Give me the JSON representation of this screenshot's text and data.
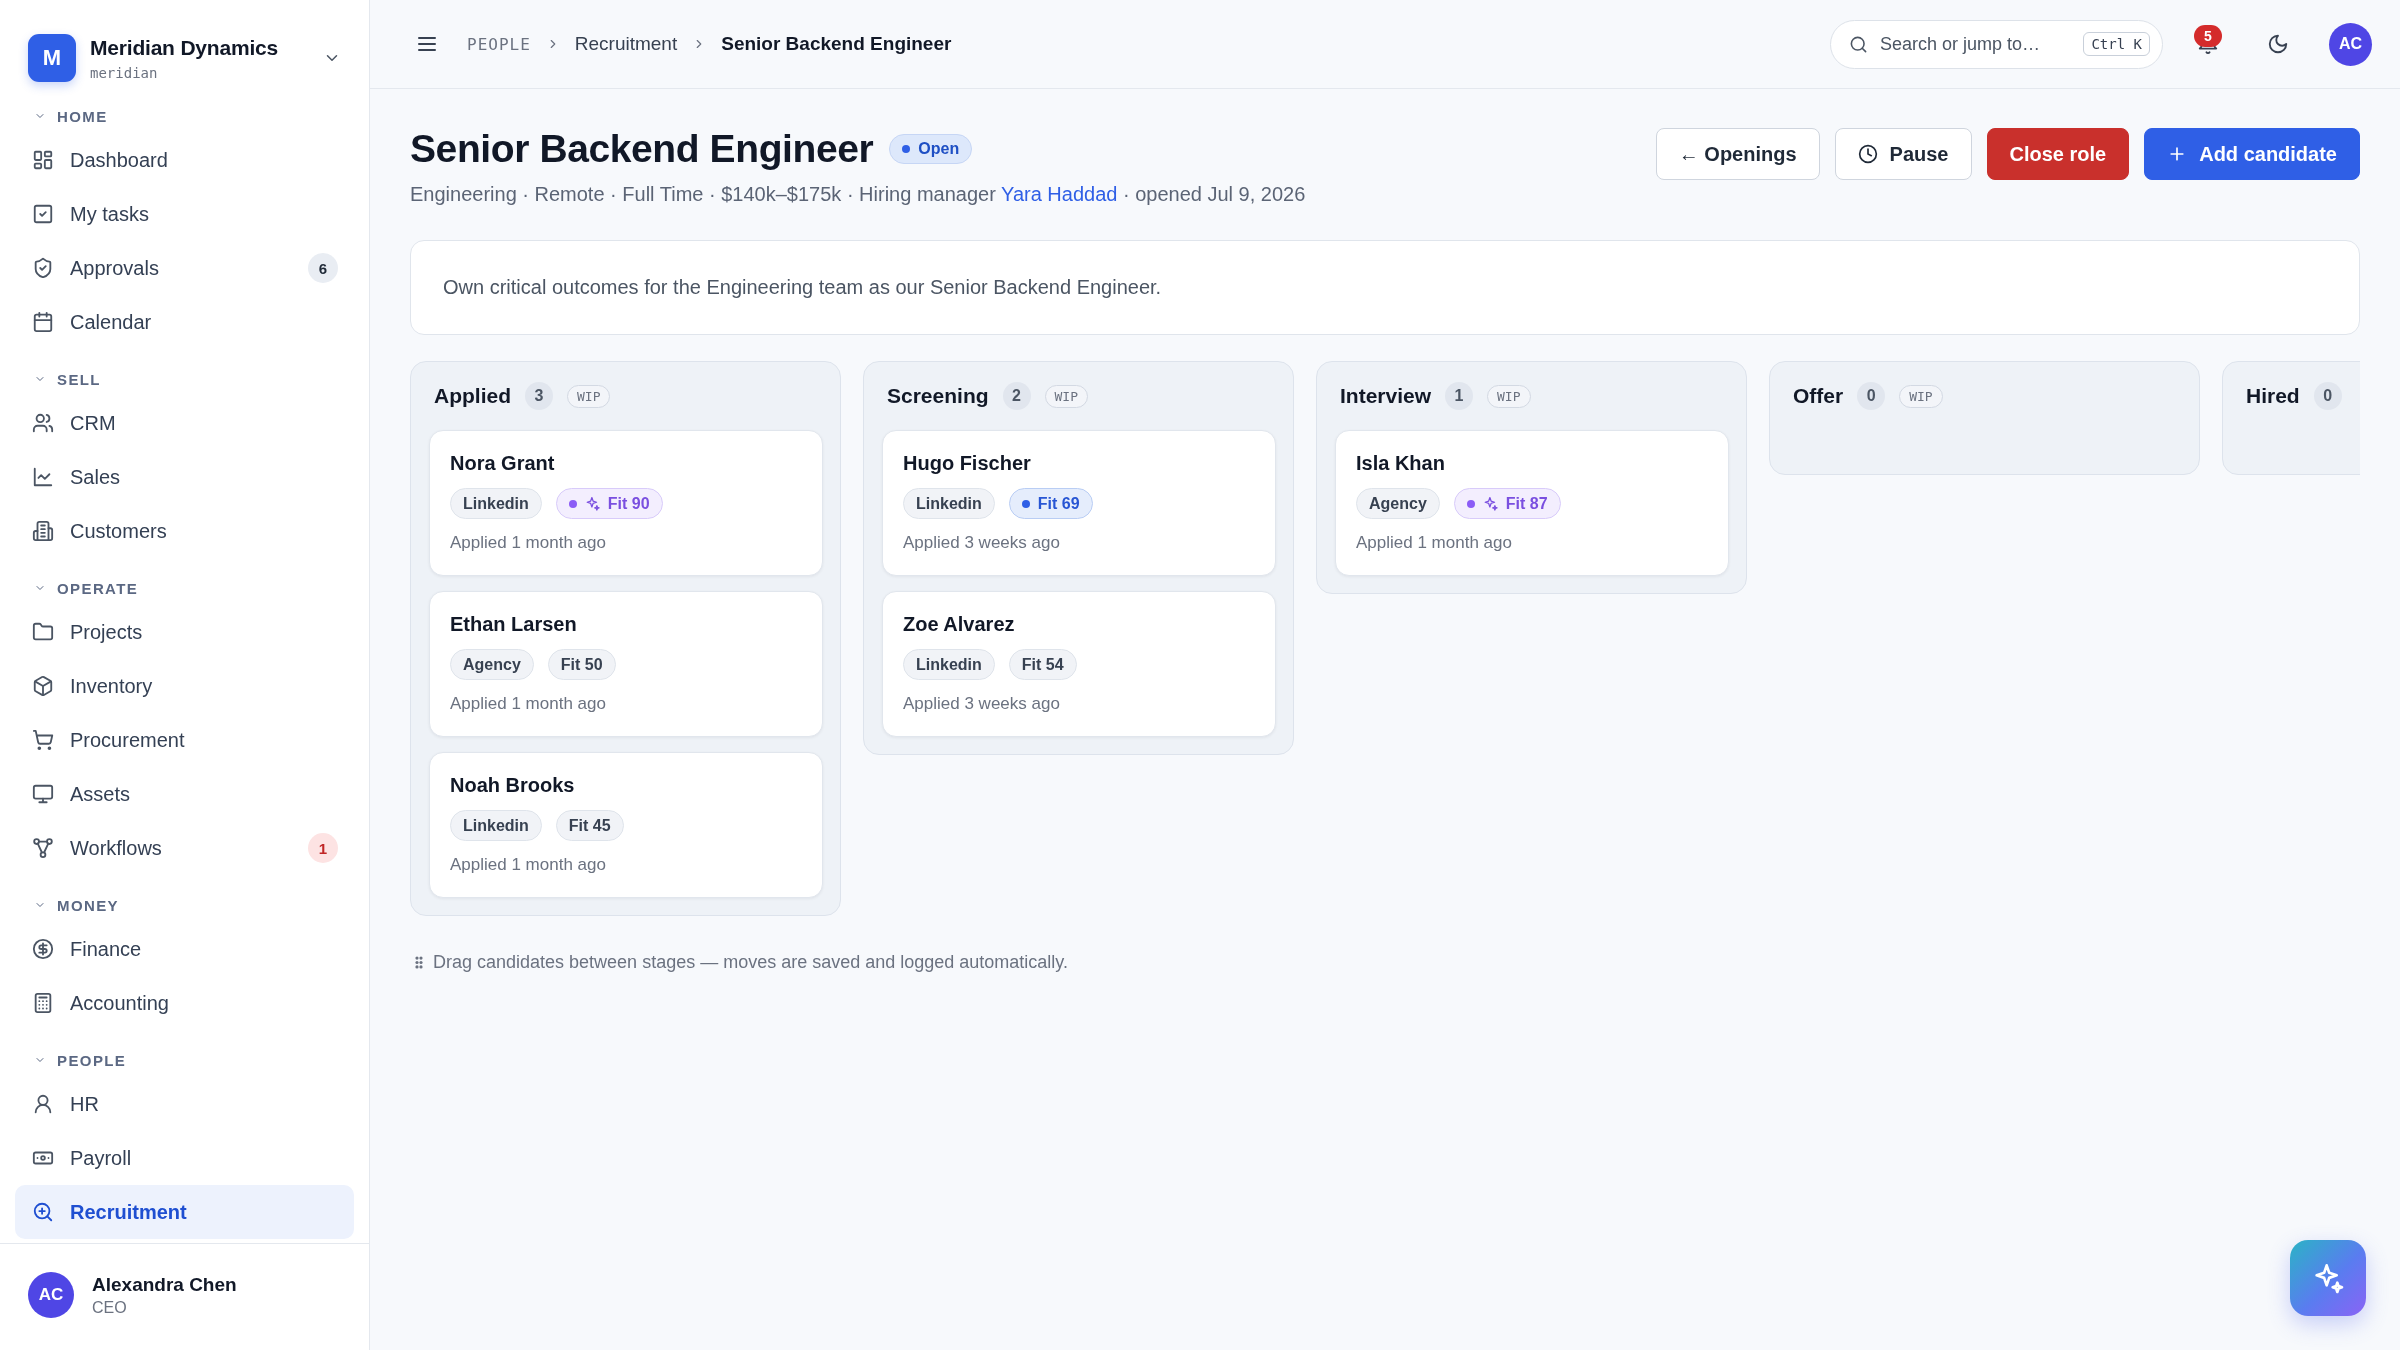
{
  "workspace": {
    "logo": "M",
    "name": "Meridian Dynamics",
    "slug": "meridian"
  },
  "sidebar": {
    "sections": [
      {
        "title": "HOME",
        "expanded": true,
        "items": [
          {
            "label": "Dashboard",
            "selected": false
          },
          {
            "label": "My tasks",
            "selected": false
          },
          {
            "label": "Approvals",
            "selected": false,
            "badge": {
              "text": "6",
              "kind": "neutral"
            }
          },
          {
            "label": "Calendar",
            "selected": false
          }
        ]
      },
      {
        "title": "SELL",
        "expanded": true,
        "items": [
          {
            "label": "CRM",
            "selected": false
          },
          {
            "label": "Sales",
            "selected": false
          },
          {
            "label": "Customers",
            "selected": false
          }
        ]
      },
      {
        "title": "OPERATE",
        "expanded": true,
        "items": [
          {
            "label": "Projects",
            "selected": false
          },
          {
            "label": "Inventory",
            "selected": false
          },
          {
            "label": "Procurement",
            "selected": false
          },
          {
            "label": "Assets",
            "selected": false
          },
          {
            "label": "Workflows",
            "selected": false,
            "badge": {
              "text": "1",
              "kind": "alert"
            }
          }
        ]
      },
      {
        "title": "MONEY",
        "expanded": true,
        "items": [
          {
            "label": "Finance",
            "selected": false
          },
          {
            "label": "Accounting",
            "selected": false
          }
        ]
      },
      {
        "title": "PEOPLE",
        "expanded": true,
        "items": [
          {
            "label": "HR",
            "selected": false
          },
          {
            "label": "Payroll",
            "selected": false
          },
          {
            "label": "Recruitment",
            "selected": true
          }
        ]
      }
    ]
  },
  "user": {
    "initials": "AC",
    "name": "Alexandra Chen",
    "role": "CEO"
  },
  "topbar": {
    "breadcrumb": [
      {
        "label": "PEOPLE",
        "kind": "root"
      },
      {
        "label": "Recruitment",
        "kind": "link"
      },
      {
        "label": "Senior Backend Engineer",
        "kind": "current"
      }
    ],
    "search": {
      "placeholder": "Search or jump to…",
      "shortcut": "Ctrl K"
    },
    "notifications": {
      "count": "5"
    },
    "avatar": {
      "initials": "AC"
    }
  },
  "role": {
    "title": "Senior Backend Engineer",
    "status": "Open",
    "meta": {
      "before": "Engineering · Remote · Full Time · $140k–$175k · Hiring manager",
      "manager": "Yara Haddad",
      "after": "· opened Jul 9, 2026"
    },
    "actions": [
      {
        "label": "← Openings",
        "kind": "outline"
      },
      {
        "label": "Pause",
        "kind": "outline"
      },
      {
        "label": "Close role",
        "kind": "danger"
      },
      {
        "label": "Add candidate",
        "kind": "primary"
      }
    ],
    "description": "Own critical outcomes for the Engineering team as our Senior Backend Engineer."
  },
  "stages": [
    {
      "name": "Applied",
      "count": "3",
      "wip": "WIP",
      "candidates": [
        {
          "name": "Nora Grant",
          "source": "Linkedin",
          "fit": {
            "label": "Fit 90",
            "kind": "top"
          },
          "applied": "Applied 1 month ago"
        },
        {
          "name": "Ethan Larsen",
          "source": "Agency",
          "fit": {
            "label": "Fit 50",
            "kind": "plain"
          },
          "applied": "Applied 1 month ago"
        },
        {
          "name": "Noah Brooks",
          "source": "Linkedin",
          "fit": {
            "label": "Fit 45",
            "kind": "plain"
          },
          "applied": "Applied 1 month ago"
        }
      ]
    },
    {
      "name": "Screening",
      "count": "2",
      "wip": "WIP",
      "candidates": [
        {
          "name": "Hugo Fischer",
          "source": "Linkedin",
          "fit": {
            "label": "Fit 69",
            "kind": "good"
          },
          "applied": "Applied 3 weeks ago"
        },
        {
          "name": "Zoe Alvarez",
          "source": "Linkedin",
          "fit": {
            "label": "Fit 54",
            "kind": "plain"
          },
          "applied": "Applied 3 weeks ago"
        }
      ]
    },
    {
      "name": "Interview",
      "count": "1",
      "wip": "WIP",
      "candidates": [
        {
          "name": "Isla Khan",
          "source": "Agency",
          "fit": {
            "label": "Fit 87",
            "kind": "top"
          },
          "applied": "Applied 1 month ago"
        }
      ]
    },
    {
      "name": "Offer",
      "count": "0",
      "wip": "WIP"
    },
    {
      "name": "Hired",
      "count": "0"
    }
  ],
  "hint": "Drag candidates between stages — moves are saved and logged automatically."
}
